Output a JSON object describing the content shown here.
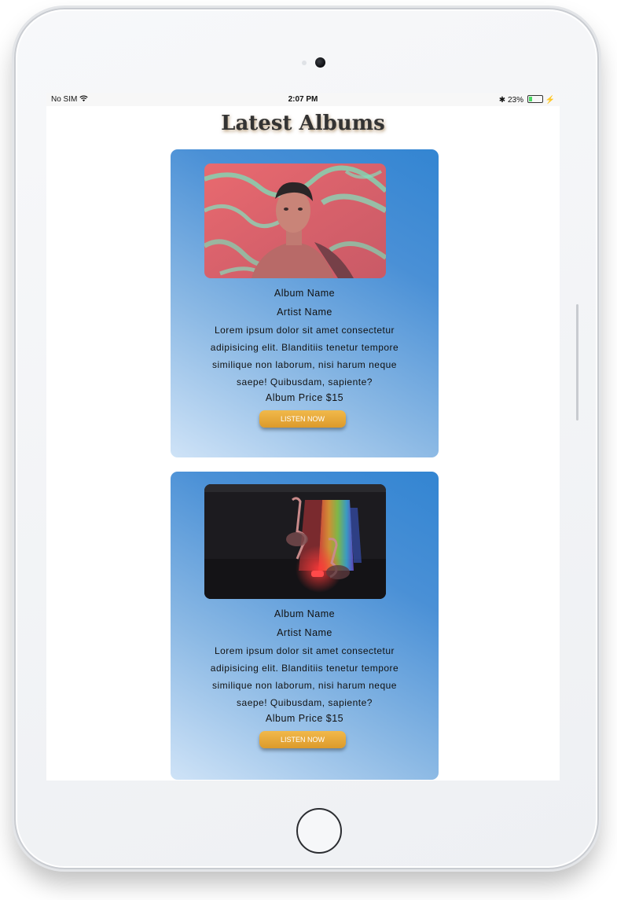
{
  "status_bar": {
    "carrier": "No SIM",
    "wifi_icon": "wifi-icon",
    "time": "2:07 PM",
    "bluetooth_icon": "bluetooth-icon",
    "battery_percent": "23%",
    "battery_level": 0.23,
    "charging_icon": "bolt-icon"
  },
  "page": {
    "title": "Latest Albums"
  },
  "albums": [
    {
      "image_icon": "album-art-portrait",
      "album_name": "Album Name",
      "artist_name": "Artist Name",
      "description": "Lorem ipsum dolor sit amet consectetur adipisicing elit. Blanditiis tenetur tempore similique non laborum, nisi harum neque saepe! Quibusdam, sapiente?",
      "price": "Album Price $15",
      "button_label": "LISTEN NOW"
    },
    {
      "image_icon": "album-art-flamingo",
      "album_name": "Album Name",
      "artist_name": "Artist Name",
      "description": "Lorem ipsum dolor sit amet consectetur adipisicing elit. Blanditiis tenetur tempore similique non laborum, nisi harum neque saepe! Quibusdam, sapiente?",
      "price": "Album Price $15",
      "button_label": "LISTEN NOW"
    }
  ],
  "colors": {
    "card_gradient_start": "#cfe3f7",
    "card_gradient_end": "#3385d2",
    "button": "#e8a93a",
    "button_text": "#ffffff"
  }
}
